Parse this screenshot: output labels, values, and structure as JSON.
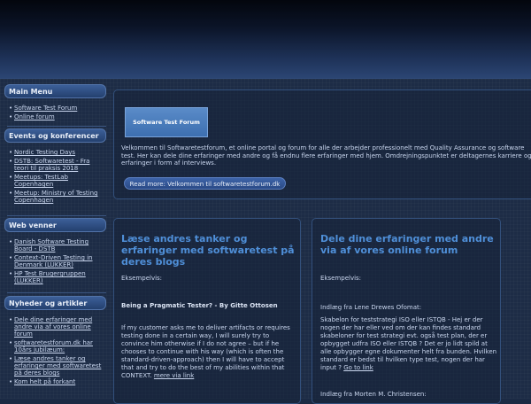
{
  "sidebar": {
    "main_menu": {
      "title": "Main Menu",
      "items": [
        "Software Test Forum",
        "Online forum"
      ]
    },
    "events": {
      "title": "Events og konferencer",
      "items": [
        "Nordic Testing Days",
        "DSTB: Softwaretest - Fra teori til praksis 2018",
        "Meetups: TestLab Copenhagen",
        "Meetup: Ministry of Testing Copenhagen"
      ]
    },
    "friends": {
      "title": "Web venner",
      "items": [
        "Danish Software Testing Board - DSTB",
        "Context-Driven Testing in Denmark (LUKKER)",
        "HP Test Brugergruppen (LUKKER)"
      ]
    },
    "news": {
      "title": "Nyheder og artikler",
      "items": [
        "Dele dine erfaringer med andre via af vores online forum",
        "softwaretestforum.dk har 10års jubilæum:",
        "Læse andres tanker og erfaringer med softwaretest på deres blogs",
        "Kom helt på forkant"
      ]
    }
  },
  "intro": {
    "logo_text": "Software Test Forum",
    "welcome": "Velkommen til Softwaretestforum, et online portal og forum for alle der arbejder professionelt med Quality Assurance og software test. Her kan dele dine erfaringer med andre og få endnu flere erfaringer med hjem. Omdrejningspunktet er deltagernes karriere og erfaringer i form af interviews.",
    "read_more": "Read more: Velkommen til softwaretestforum.dk"
  },
  "left_article": {
    "title": "Læse andres tanker og erfaringer med softwaretest på deres blogs",
    "example_label": "Eksempelvis:",
    "subtitle": "Being a Pragmatic Tester?  -  By Gitte Ottosen",
    "body": "If my customer asks me to deliver artifacts or requires testing done in a certain way, I will surely try to convince him otherwise if I do not agree – but if he chooses to continue with his way (which is often the standard-driven-approach) then I will have to accept that and try to do the best of my abilities within that CONTEXT.",
    "link": "mere via link"
  },
  "right_article": {
    "title": "Dele dine erfaringer med andre via af vores online forum",
    "example_label": "Eksempelvis:",
    "from1": "Indlæg fra Lene Drewes Ofomat:",
    "body": "Skabelon for teststrategi ISO eller ISTQB - Hej er der nogen der har eller ved om der kan findes standard skabeloner for test strategi evt. også test plan, der er opbygget udfra ISO eller ISTQB ? Det er jo lidt spild at alle opbygger egne dokumenter helt fra bunden. Hvilken standard er bedst til hvilken type test, nogen der har input ?",
    "link": "Go to link",
    "from2": "Indlæg fra Morten M. Christensen:"
  }
}
